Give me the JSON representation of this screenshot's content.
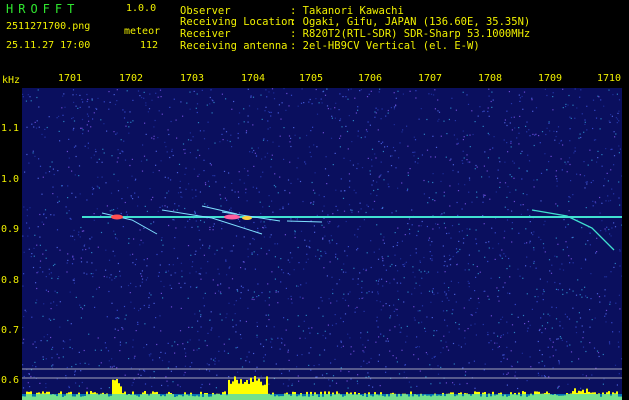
{
  "header": {
    "logo": "HROFFT",
    "version": "1.0.0",
    "filename": "2511271700.png",
    "mode_label": "meteor",
    "datetime": "25.11.27 17:00",
    "count": "112",
    "observer_label": "Observer",
    "observer_value": ": Takanori Kawachi",
    "location_label": "Receiving Location",
    "location_value": ": Ogaki, Gifu, JAPAN (136.60E, 35.35N)",
    "receiver_label": "Receiver",
    "receiver_value": ": R820T2(RTL-SDR) SDR-Sharp 53.1000MHz",
    "antenna_label": "Receiving antenna",
    "antenna_value": ": 2el-HB9CV Vertical (el. E-W)"
  },
  "axes": {
    "y_unit": "kHz",
    "x_ticks": [
      "1701",
      "1702",
      "1703",
      "1704",
      "1705",
      "1706",
      "1707",
      "1708",
      "1709",
      "1710"
    ],
    "y_ticks": [
      "1.1",
      "1.0",
      "0.9",
      "0.8",
      "0.7",
      "0.6"
    ]
  },
  "colors": {
    "background": "#0a0f5e",
    "carrier": "#40e0d0",
    "text": "#f0f000",
    "logo": "#2fe62f",
    "activity": "#ffff00"
  }
}
